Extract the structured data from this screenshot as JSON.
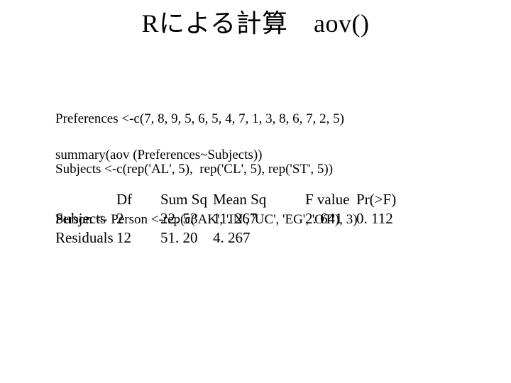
{
  "title": "Rによる計算　aov()",
  "code": {
    "line1": "Preferences <-c(7, 8, 9, 5, 6, 5, 4, 7, 1, 3, 8, 6, 7, 2, 5)",
    "line2": "Subjects <-c(rep('AL', 5),  rep('CL', 5), rep('ST', 5))",
    "line3": "Person <- Person <-rep(c('AK', 'IN', 'UC', 'EG', 'OT'), 3)"
  },
  "summary_call": "summary(aov (Preferences~Subjects))",
  "anova": {
    "headers": {
      "df": "Df",
      "sumsq": "Sum Sq",
      "meansq": "Mean Sq",
      "fvalue": "F value",
      "prf": "Pr(>F)"
    },
    "rows": [
      {
        "label": "Subjects",
        "df": "2",
        "sumsq": "22. 53",
        "meansq": "11. 267",
        "fvalue": "2. 641",
        "prf": "0. 112"
      },
      {
        "label": "Residuals",
        "df": "12",
        "sumsq": "51. 20",
        "meansq": "4. 267",
        "fvalue": "",
        "prf": ""
      }
    ]
  }
}
